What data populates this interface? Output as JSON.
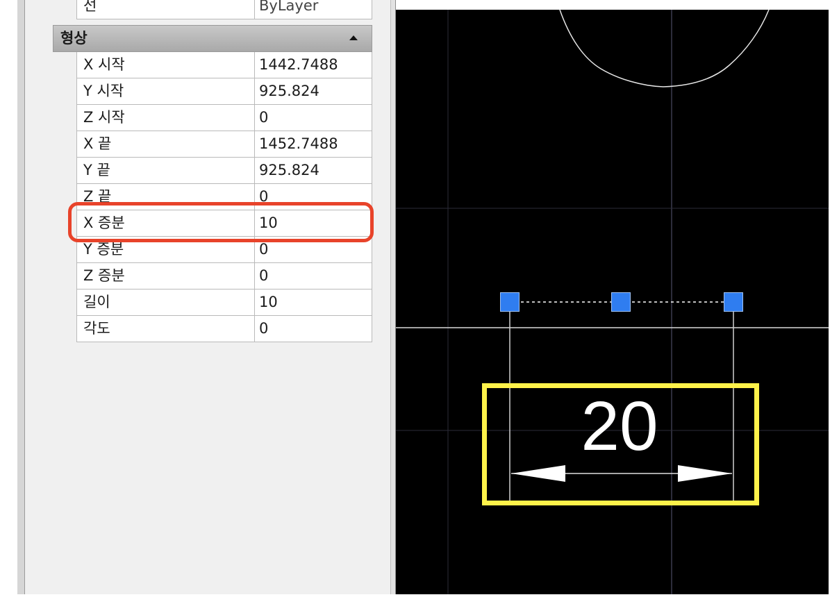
{
  "properties": {
    "top_row": {
      "label": "선",
      "value": "ByLayer"
    },
    "section_title": "형상",
    "rows": [
      {
        "label": "X 시작",
        "value": "1442.7488"
      },
      {
        "label": "Y 시작",
        "value": "925.824"
      },
      {
        "label": "Z 시작",
        "value": "0"
      },
      {
        "label": "X 끝",
        "value": "1452.7488"
      },
      {
        "label": "Y 끝",
        "value": "925.824"
      },
      {
        "label": "Z 끝",
        "value": "0"
      },
      {
        "label": "X 증분",
        "value": "10"
      },
      {
        "label": "Y 증분",
        "value": "0"
      },
      {
        "label": "Z 증분",
        "value": "0"
      },
      {
        "label": "길이",
        "value": "10"
      },
      {
        "label": "각도",
        "value": "0"
      }
    ]
  },
  "drawing": {
    "dimension_text": "20",
    "highlight_colors": {
      "red": "#e8432a",
      "yellow": "#fff24a"
    },
    "grip_color": "#2f7df0"
  }
}
